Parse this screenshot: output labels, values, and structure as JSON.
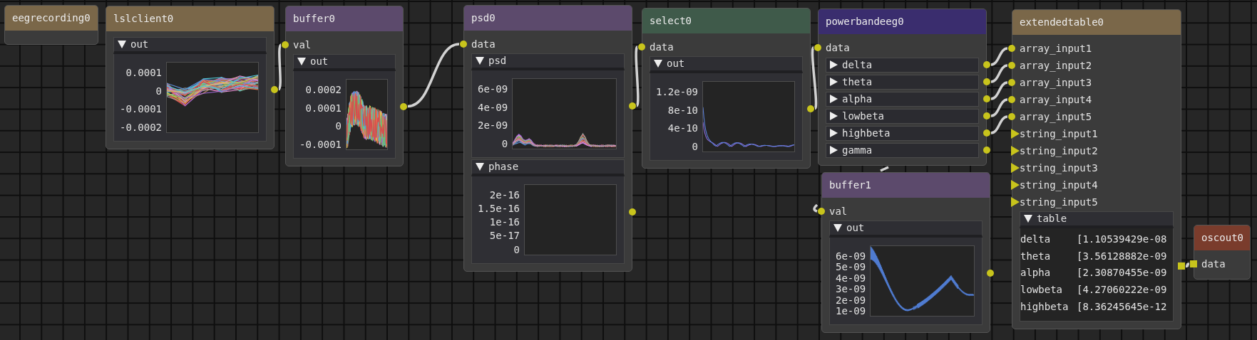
{
  "nodes": [
    {
      "title": "eegrecording0",
      "color": "#7a6749"
    },
    {
      "title": "lslclient0",
      "color": "#7a6749",
      "rows": [
        {
          "kind": "plot",
          "title": "out",
          "expanded": true,
          "ticks": [
            "0.0001",
            "0",
            "-0.0001",
            "-0.0002"
          ],
          "graph": {
            "kind": "lines"
          }
        }
      ]
    },
    {
      "title": "buffer0",
      "color": "#5c4a6c",
      "rows": [
        {
          "kind": "input",
          "label": "val",
          "pin": {
            "kind": "circle"
          }
        },
        {
          "kind": "plot",
          "title": "out",
          "expanded": true,
          "ticks": [
            "0.0002",
            "0.0001",
            "0",
            "-0.0001"
          ],
          "graph": {
            "kind": "noise"
          }
        }
      ]
    },
    {
      "title": "psd0",
      "color": "#5c4a6c",
      "rows": [
        {
          "kind": "input",
          "label": "data",
          "pin": {
            "kind": "circle"
          }
        },
        {
          "kind": "plot",
          "title": "psd",
          "expanded": true,
          "ticks": [
            "6e-09",
            "4e-09",
            "2e-09",
            "0"
          ],
          "graph": {
            "kind": "peaks"
          }
        },
        {
          "kind": "plot",
          "title": "phase",
          "expanded": true,
          "ticks": [
            "2e-16",
            "1.5e-16",
            "1e-16",
            "5e-17",
            "0"
          ]
        }
      ]
    },
    {
      "title": "select0",
      "color": "#3f5a4a",
      "rows": [
        {
          "kind": "input",
          "label": "data",
          "pin": {
            "kind": "circle"
          }
        },
        {
          "kind": "plot",
          "title": "out",
          "expanded": true,
          "ticks": [
            "1.2e-09",
            "8e-10",
            "4e-10",
            "0"
          ],
          "graph": {
            "kind": "decay"
          }
        }
      ]
    },
    {
      "title": "powerbandeeg0",
      "color": "#3a2d6e",
      "rows": [
        {
          "kind": "input",
          "label": "data",
          "pin": {
            "kind": "circle"
          }
        },
        {
          "kind": "band",
          "title": "delta",
          "expanded": false
        },
        {
          "kind": "band",
          "title": "theta",
          "expanded": false
        },
        {
          "kind": "band",
          "title": "alpha",
          "expanded": false
        },
        {
          "kind": "band",
          "title": "lowbeta",
          "expanded": false
        },
        {
          "kind": "band",
          "title": "highbeta",
          "expanded": false
        },
        {
          "kind": "band",
          "title": "gamma",
          "expanded": false
        }
      ]
    },
    {
      "title": "buffer1",
      "color": "#5c4a6c",
      "rows": [
        {
          "kind": "input",
          "label": "val",
          "pin": {
            "kind": "circle"
          }
        },
        {
          "kind": "plot",
          "title": "out",
          "expanded": true,
          "ticks": [
            "6e-09",
            "5e-09",
            "4e-09",
            "3e-09",
            "2e-09",
            "1e-09"
          ],
          "graph": {
            "kind": "wave"
          }
        }
      ]
    },
    {
      "title": "extendedtable0",
      "color": "#7a6749",
      "rows": [
        {
          "kind": "input",
          "label": "array_input1",
          "pin": {
            "kind": "circle"
          }
        },
        {
          "kind": "input",
          "label": "array_input2",
          "pin": {
            "kind": "circle"
          }
        },
        {
          "kind": "input",
          "label": "array_input3",
          "pin": {
            "kind": "circle"
          }
        },
        {
          "kind": "input",
          "label": "array_input4",
          "pin": {
            "kind": "circle"
          }
        },
        {
          "kind": "input",
          "label": "array_input5",
          "pin": {
            "kind": "circle"
          }
        },
        {
          "kind": "input",
          "label": "string_input1",
          "pin": {
            "kind": "triangle"
          }
        },
        {
          "kind": "input",
          "label": "string_input2",
          "pin": {
            "kind": "triangle"
          }
        },
        {
          "kind": "input",
          "label": "string_input3",
          "pin": {
            "kind": "triangle"
          }
        },
        {
          "kind": "input",
          "label": "string_input4",
          "pin": {
            "kind": "triangle"
          }
        },
        {
          "kind": "input",
          "label": "string_input5",
          "pin": {
            "kind": "triangle"
          }
        },
        {
          "kind": "table",
          "title": "table",
          "expanded": true,
          "rows": [
            {
              "name": "delta",
              "value": "[1.10539429e-08"
            },
            {
              "name": "theta",
              "value": "[3.56128882e-09"
            },
            {
              "name": "alpha",
              "value": "[2.30870455e-09"
            },
            {
              "name": "lowbeta",
              "value": "[4.27060222e-09"
            },
            {
              "name": "highbeta",
              "value": "[8.36245645e-12"
            }
          ]
        }
      ]
    },
    {
      "title": "oscout0",
      "color": "#7a3c2c",
      "rows": [
        {
          "kind": "input",
          "label": "data",
          "pin": {
            "kind": "square"
          }
        }
      ]
    }
  ]
}
